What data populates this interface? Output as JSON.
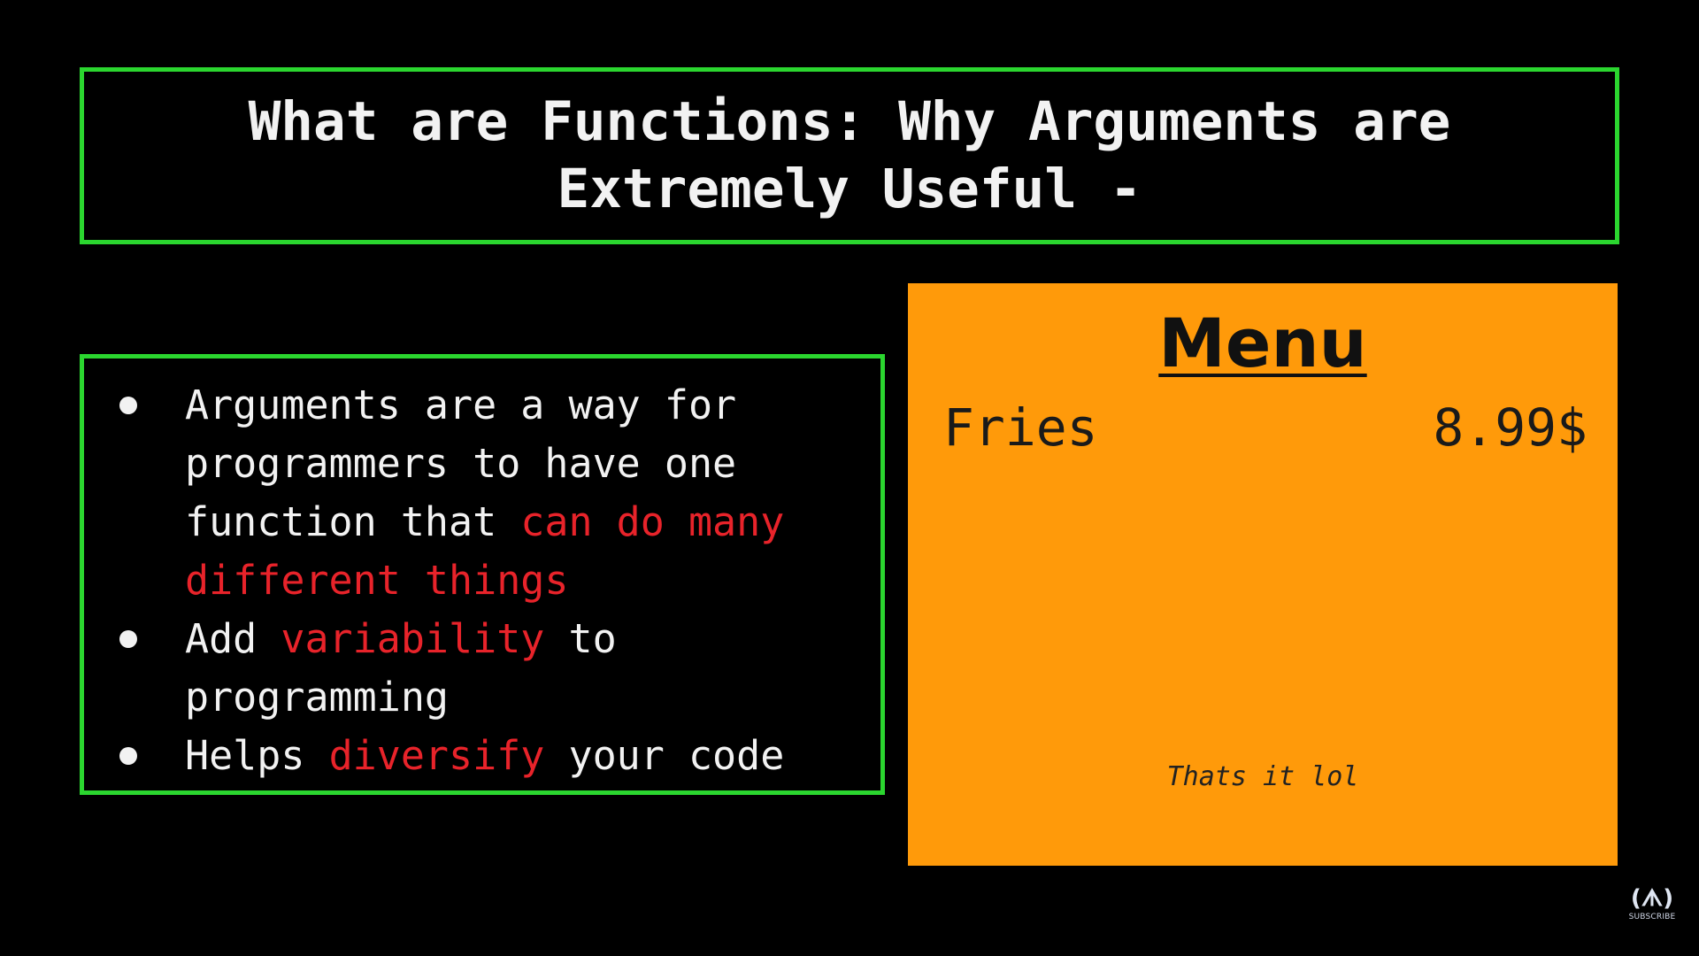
{
  "slide": {
    "title_line1": "What are Functions: Why Arguments are",
    "title_line2": "Extremely Useful -",
    "bullets": [
      {
        "text_before": "Arguments are a way for programmers to have one function that ",
        "highlight": "can do many different things",
        "text_after": ""
      },
      {
        "text_before": "Add ",
        "highlight": "variability",
        "text_after": " to programming"
      },
      {
        "text_before": "Helps ",
        "highlight": "diversify",
        "text_after": " your code"
      }
    ],
    "colors": {
      "background": "#000000",
      "frame": "#2bd62f",
      "highlight": "#e8232a",
      "menu_background": "#ff9a0a"
    }
  },
  "menu": {
    "title": "Menu",
    "items": [
      {
        "name": "Fries",
        "price": "8.99$"
      }
    ],
    "footer": "Thats it lol"
  },
  "badge": {
    "logo": "(ᗑ)",
    "label": "SUBSCRIBE",
    "icon": "freecodecamp-flame-icon"
  }
}
